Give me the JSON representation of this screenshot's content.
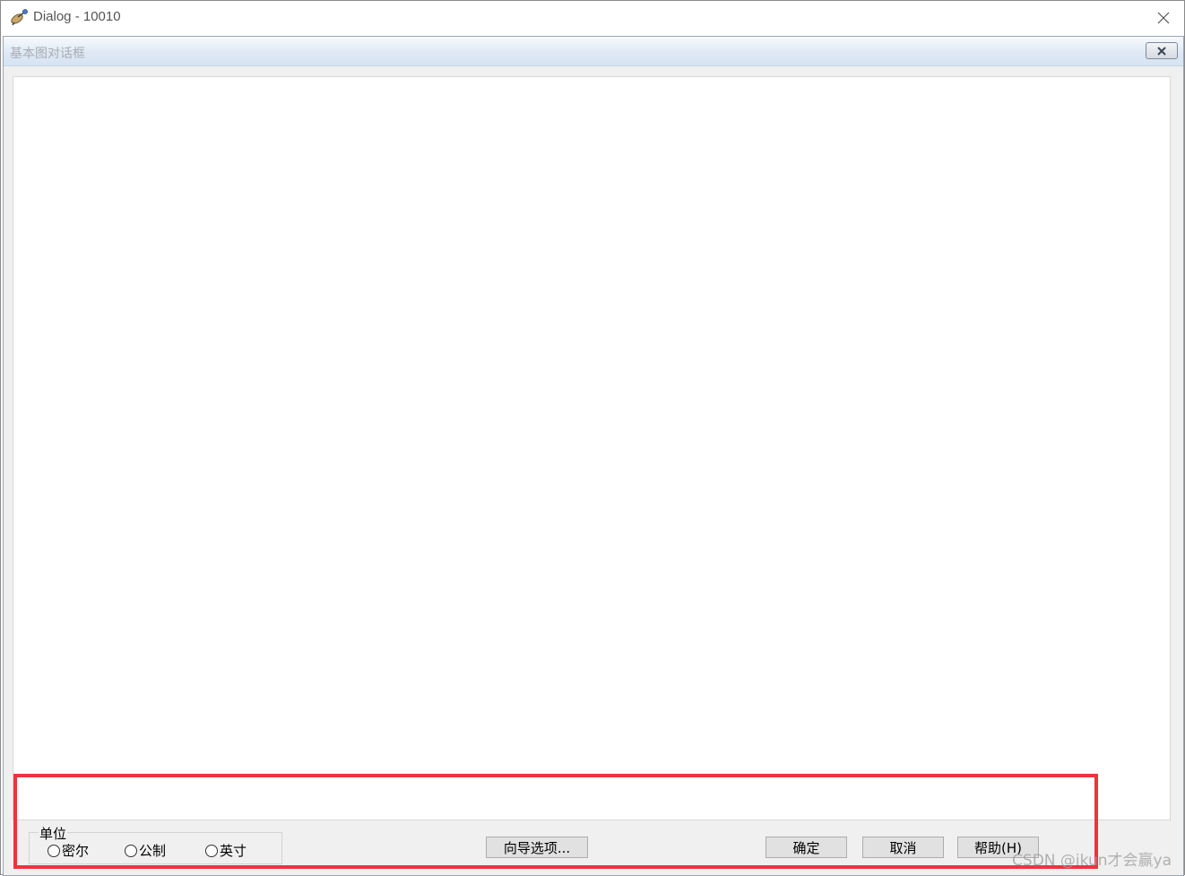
{
  "window": {
    "title": "Dialog -  10010"
  },
  "dialog": {
    "caption": "基本图对话框"
  },
  "units": {
    "legend": "单位",
    "options": [
      "密尔",
      "公制",
      "英寸"
    ]
  },
  "buttons": {
    "wizard_options": "向导选项...",
    "ok": "确定",
    "cancel": "取消",
    "help": "帮助(H)"
  },
  "watermark": "CSDN @ikun才会赢ya",
  "colors": {
    "highlight": "#f0333b",
    "dialog_bg": "#f0f0f0"
  },
  "icons": {
    "app": "satellite-dish-icon",
    "close": "close-icon",
    "caption_close": "close-icon"
  }
}
